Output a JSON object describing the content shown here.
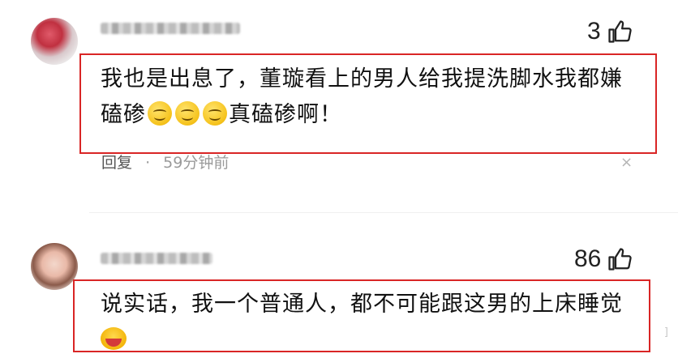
{
  "comments": [
    {
      "like_count": "3",
      "text_line1": "我也是出息了，董璇看上的男人给我提洗脚水我都嫌",
      "text_line2_prefix": "磕碜",
      "text_line2_suffix": "真磕碜啊！",
      "reply_label": "回复",
      "separator": "·",
      "time": "59分钟前",
      "close_glyph": "×"
    },
    {
      "like_count": "86",
      "text_line1": "说实话，我一个普通人，都不可能跟这男的上床睡觉"
    }
  ],
  "highlight_color": "#d92525",
  "watermark": "]"
}
